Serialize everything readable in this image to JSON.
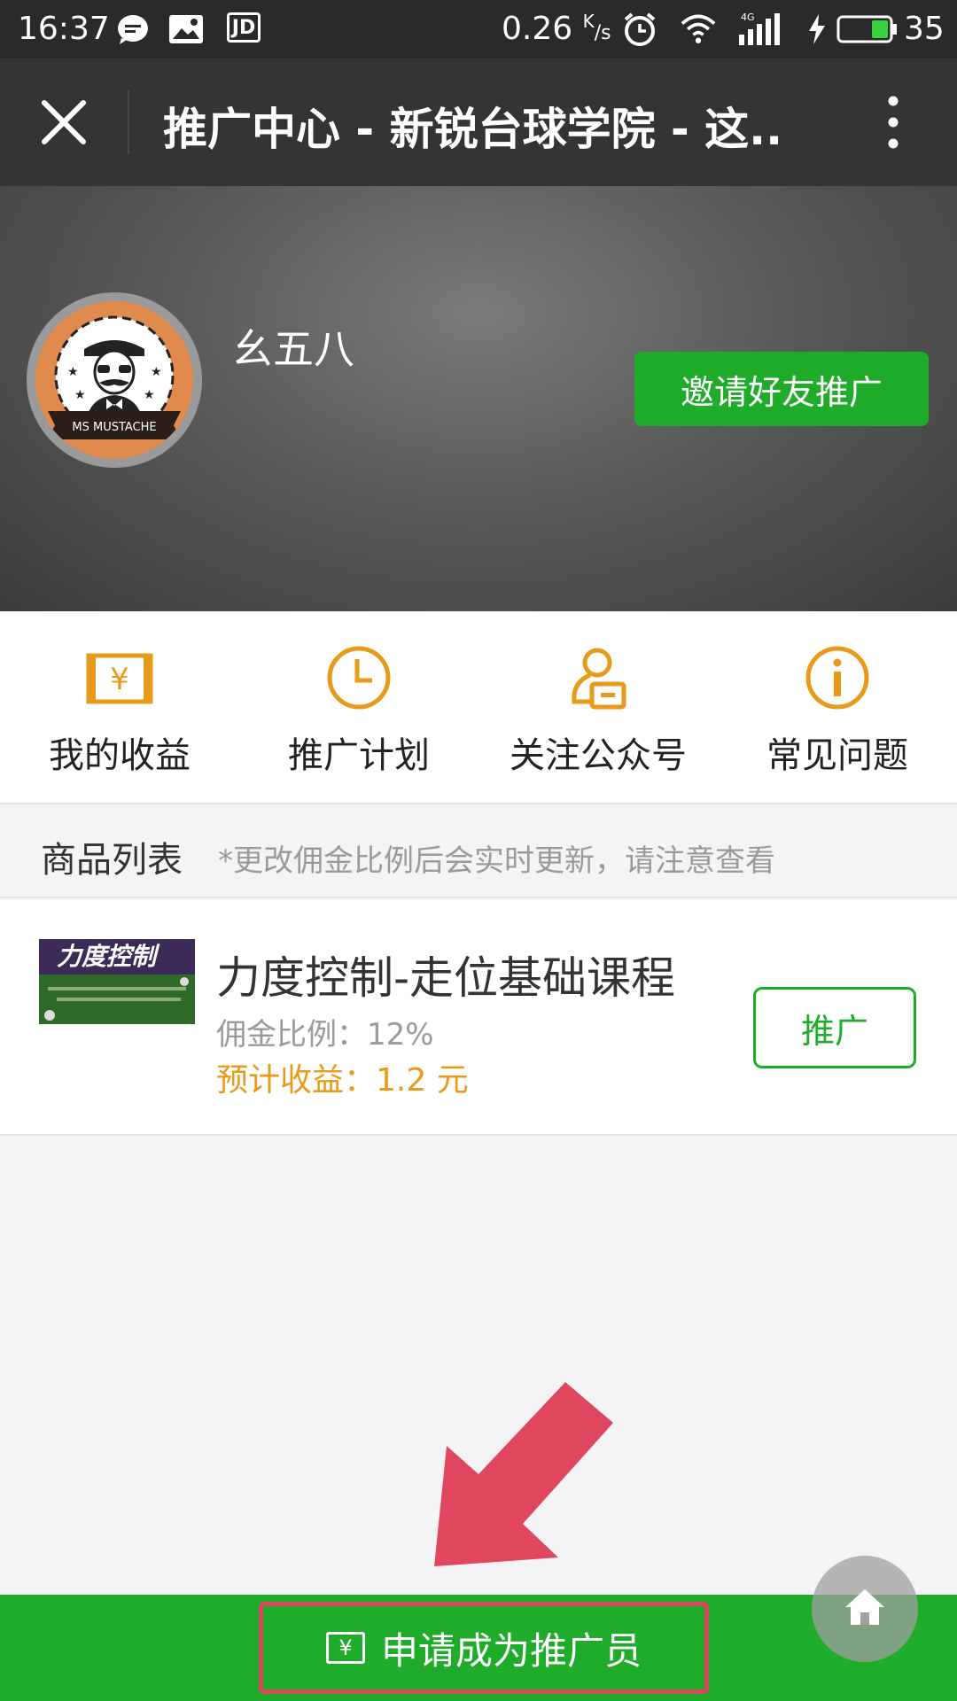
{
  "status_bar": {
    "time": "16:37",
    "speed_value": "0.26",
    "speed_unit_top": "K",
    "speed_unit_bottom": "/s",
    "network": "4G",
    "battery": "35",
    "icons": [
      "chat-bubble-icon",
      "image-icon",
      "jd-icon",
      "alarm-icon",
      "wifi-icon",
      "signal-icon",
      "charging-icon",
      "battery-icon"
    ],
    "jd_label": "JD"
  },
  "title_bar": {
    "title": "推广中心 - 新锐台球学院 - 这..",
    "close_icon": "close-icon",
    "more_icon": "more-vertical-icon"
  },
  "profile": {
    "username": "幺五八",
    "invite_label": "邀请好友推广",
    "avatar_banner": "MS MUSTACHE"
  },
  "menu": {
    "items": [
      {
        "label": "我的收益",
        "icon": "yen-wallet-icon"
      },
      {
        "label": "推广计划",
        "icon": "clock-icon"
      },
      {
        "label": "关注公众号",
        "icon": "user-card-icon"
      },
      {
        "label": "常见问题",
        "icon": "info-icon"
      }
    ]
  },
  "list": {
    "title": "商品列表",
    "note": "*更改佣金比例后会实时更新，请注意查看"
  },
  "product": {
    "thumb_text": "力度控制",
    "name": "力度控制-走位基础课程",
    "commission": "佣金比例：12%",
    "income": "预计收益：1.2 元",
    "promote_label": "推广"
  },
  "bottom": {
    "apply_label": "申请成为推广员",
    "apply_icon": "yen-box-icon",
    "yen_symbol": "¥"
  },
  "colors": {
    "accent_green": "#1fac2a",
    "icon_orange": "#e89a1a",
    "annotation_red": "#d9495a"
  }
}
